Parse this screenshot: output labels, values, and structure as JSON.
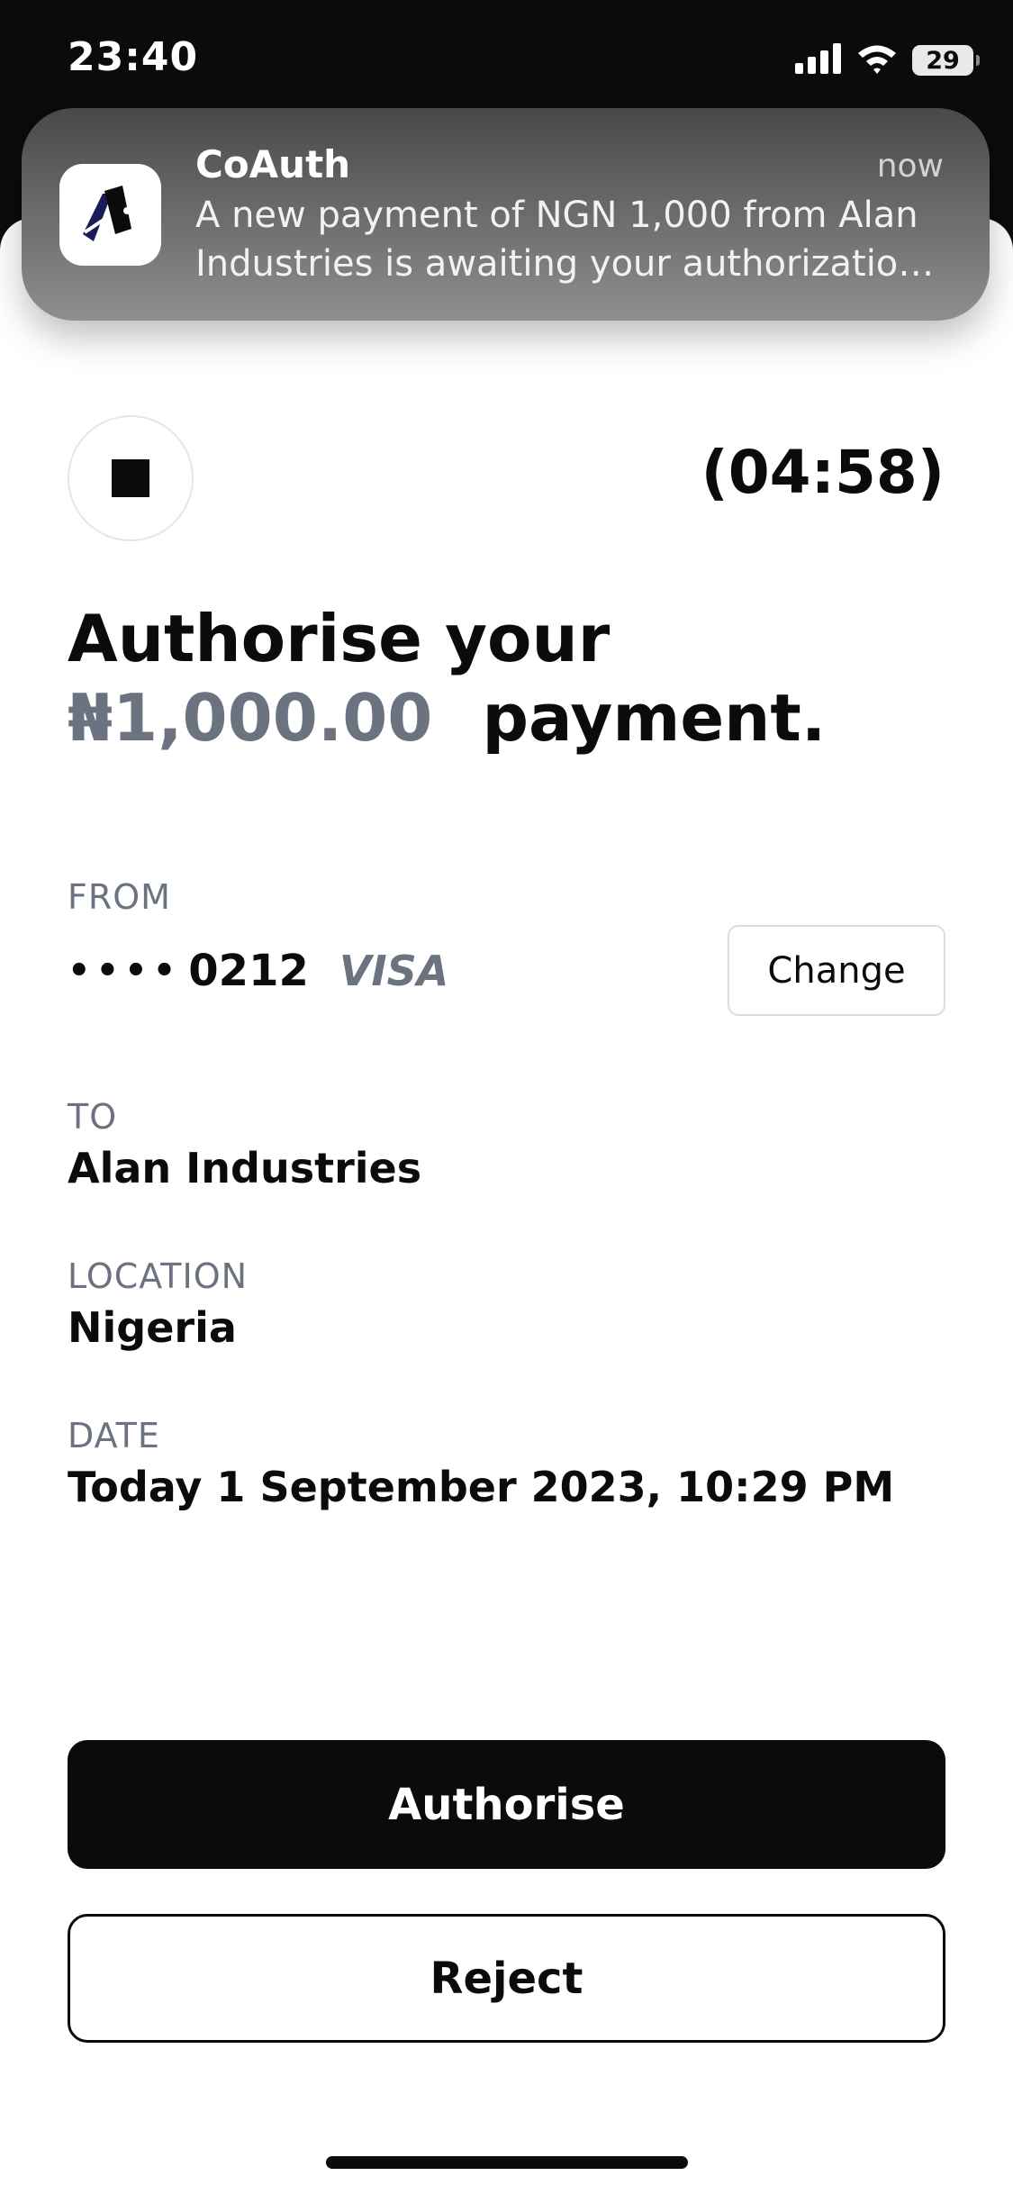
{
  "status_bar": {
    "time": "23:40",
    "battery": "29",
    "icons": [
      "signal-icon",
      "wifi-icon",
      "battery-icon"
    ]
  },
  "notification": {
    "app_name": "CoAuth",
    "time": "now",
    "body_line1": "A new payment of NGN 1,000 from Alan",
    "body_line2": "Industries is awaiting your authorizatio…",
    "icon": "coauth-app-icon"
  },
  "payment": {
    "timer": "(04:58)",
    "headline_prefix": "Authorise your",
    "amount": "₦1,000.00",
    "headline_suffix": "payment.",
    "stop_icon": "stop-icon"
  },
  "details": {
    "from_label": "FROM",
    "card_masked": "••••",
    "card_last4": "0212",
    "card_brand": "VISA",
    "change_label": "Change",
    "to_label": "TO",
    "to_value": "Alan Industries",
    "location_label": "LOCATION",
    "location_value": "Nigeria",
    "date_label": "DATE",
    "date_value": "Today 1 September 2023, 10:29 PM"
  },
  "actions": {
    "authorise_label": "Authorise",
    "reject_label": "Reject"
  },
  "colors": {
    "primary": "#0b0b0d",
    "muted_text": "#6b7280",
    "surface": "#ffffff"
  }
}
